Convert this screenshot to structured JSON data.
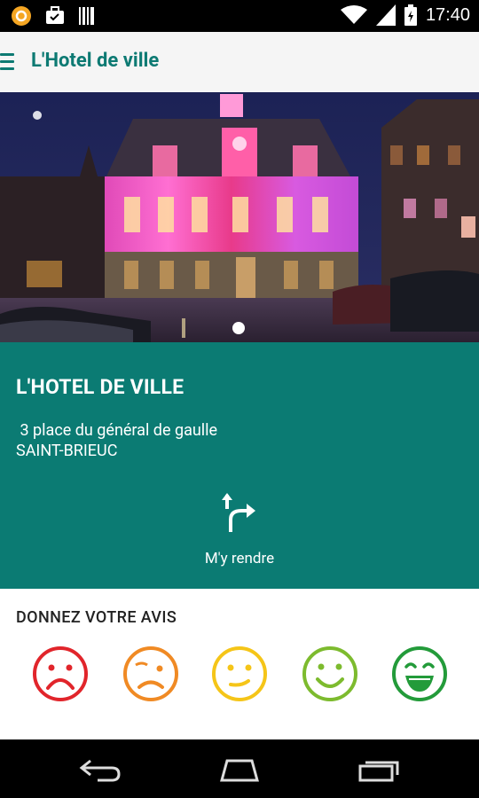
{
  "status_bar": {
    "time": "17:40",
    "left_icons": [
      "app-notification-icon",
      "briefcase-icon",
      "barcode-icon"
    ],
    "right_icons": [
      "wifi-icon",
      "signal-icon",
      "battery-icon"
    ]
  },
  "app_bar": {
    "title": "L'Hotel de ville",
    "menu_icon": "hamburger-menu-icon"
  },
  "place": {
    "name": "L'HOTEL DE VILLE",
    "address": " 3 place du général de gaulle",
    "city": "SAINT-BRIEUC",
    "directions_label": "M'y rendre",
    "directions_icon": "turn-right-arrow-icon"
  },
  "rating": {
    "title": "DONNEZ VOTRE AVIS",
    "faces": [
      {
        "name": "very-sad-face-icon",
        "color": "#e1252b"
      },
      {
        "name": "sad-face-icon",
        "color": "#f08a24"
      },
      {
        "name": "neutral-face-icon",
        "color": "#f5c518"
      },
      {
        "name": "smile-face-icon",
        "color": "#7dbb2e"
      },
      {
        "name": "big-smile-face-icon",
        "color": "#239b3a"
      }
    ]
  },
  "colors": {
    "primary": "#0b7b73",
    "title_text": "#0d7a73"
  },
  "nav_bar": {
    "icons": [
      "back-icon",
      "home-icon",
      "recent-apps-icon"
    ]
  }
}
